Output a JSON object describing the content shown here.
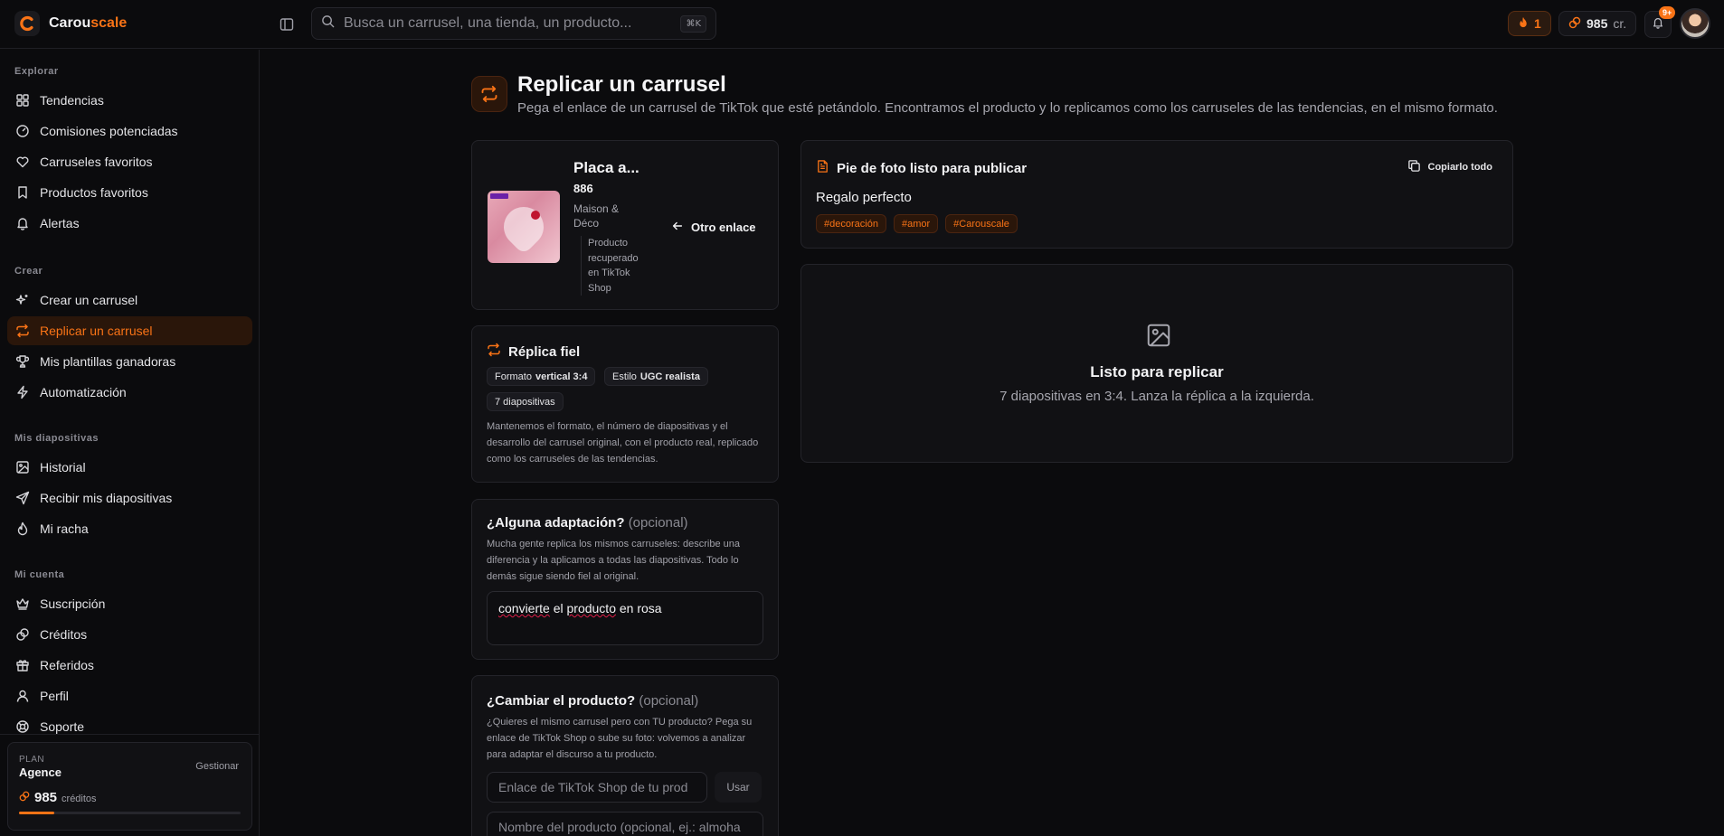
{
  "brand": {
    "name_start": "Carou",
    "name_accent": "scale"
  },
  "search": {
    "placeholder": "Busca un carrusel, una tienda, un producto...",
    "shortcut": "⌘K"
  },
  "topbar": {
    "streak": "1",
    "credits": "985",
    "credits_unit": "cr.",
    "notifications_badge": "9+"
  },
  "sidebar": {
    "sections": [
      {
        "label": "Explorar",
        "items": [
          {
            "label": "Tendencias",
            "icon": "grid-icon"
          },
          {
            "label": "Comisiones potenciadas",
            "icon": "gauge-icon"
          },
          {
            "label": "Carruseles favoritos",
            "icon": "heart-icon"
          },
          {
            "label": "Productos favoritos",
            "icon": "bookmark-icon"
          },
          {
            "label": "Alertas",
            "icon": "bell-icon"
          }
        ]
      },
      {
        "label": "Crear",
        "items": [
          {
            "label": "Crear un carrusel",
            "icon": "sparkles-icon"
          },
          {
            "label": "Replicar un carrusel",
            "icon": "repeat-icon",
            "active": true
          },
          {
            "label": "Mis plantillas ganadoras",
            "icon": "trophy-icon"
          },
          {
            "label": "Automatización",
            "icon": "zap-icon"
          }
        ]
      },
      {
        "label": "Mis diapositivas",
        "items": [
          {
            "label": "Historial",
            "icon": "image-icon"
          },
          {
            "label": "Recibir mis diapositivas",
            "icon": "send-icon"
          },
          {
            "label": "Mi racha",
            "icon": "flame-icon"
          }
        ]
      },
      {
        "label": "Mi cuenta",
        "items": [
          {
            "label": "Suscripción",
            "icon": "crown-icon"
          },
          {
            "label": "Créditos",
            "icon": "coins-icon"
          },
          {
            "label": "Referidos",
            "icon": "gift-icon"
          },
          {
            "label": "Perfil",
            "icon": "user-icon"
          },
          {
            "label": "Soporte",
            "icon": "lifebuoy-icon"
          }
        ]
      }
    ],
    "plan": {
      "label": "PLAN",
      "name": "Agence",
      "manage": "Gestionar",
      "credits": "985",
      "credits_unit": "créditos",
      "usage_fraction": 0.16
    }
  },
  "page": {
    "title": "Replicar un carrusel",
    "subtitle": "Pega el enlace de un carrusel de TikTok que esté petándolo. Encontramos el producto y lo replicamos como los carruseles de las tendencias, en el mismo formato."
  },
  "product": {
    "name": "Placa a...",
    "price": "886",
    "shop": "Maison & Déco",
    "source": "Producto recuperado en TikTok Shop",
    "other_link": "Otro enlace"
  },
  "replica": {
    "title": "Réplica fiel",
    "format_label": "Formato",
    "format_value": "vertical 3:4",
    "style_label": "Estilo",
    "style_value": "UGC realista",
    "slides": "7 diapositivas",
    "description": "Mantenemos el formato, el número de diapositivas y el desarrollo del carrusel original, con el producto real, replicado como los carruseles de las tendencias."
  },
  "adaptation": {
    "title": "¿Alguna adaptación?",
    "optional": "(opcional)",
    "description": "Mucha gente replica los mismos carruseles: describe una diferencia y la aplicamos a todas las diapositivas. Todo lo demás sigue siendo fiel al original.",
    "value_word1": "convierte",
    "value_mid": " el ",
    "value_word2": "producto",
    "value_end": " en rosa"
  },
  "change_product": {
    "title": "¿Cambiar el producto?",
    "optional": "(opcional)",
    "description": "¿Quieres el mismo carrusel pero con TU producto? Pega su enlace de TikTok Shop o sube su foto: volvemos a analizar para adaptar el discurso a tu producto.",
    "link_placeholder": "Enlace de TikTok Shop de tu prod",
    "use_button": "Usar",
    "name_placeholder": "Nombre del producto (opcional, ej.: almoha"
  },
  "caption": {
    "title": "Pie de foto listo para publicar",
    "copy_all": "Copiarlo todo",
    "text": "Regalo perfecto",
    "tags": [
      "decoración",
      "amor",
      "Carouscale"
    ]
  },
  "ready": {
    "title": "Listo para replicar",
    "subtitle": "7 diapositivas en 3:4. Lanza la réplica a la izquierda."
  },
  "colors": {
    "accent": "#f97316",
    "background": "#0b0b0d",
    "card": "#111114"
  }
}
